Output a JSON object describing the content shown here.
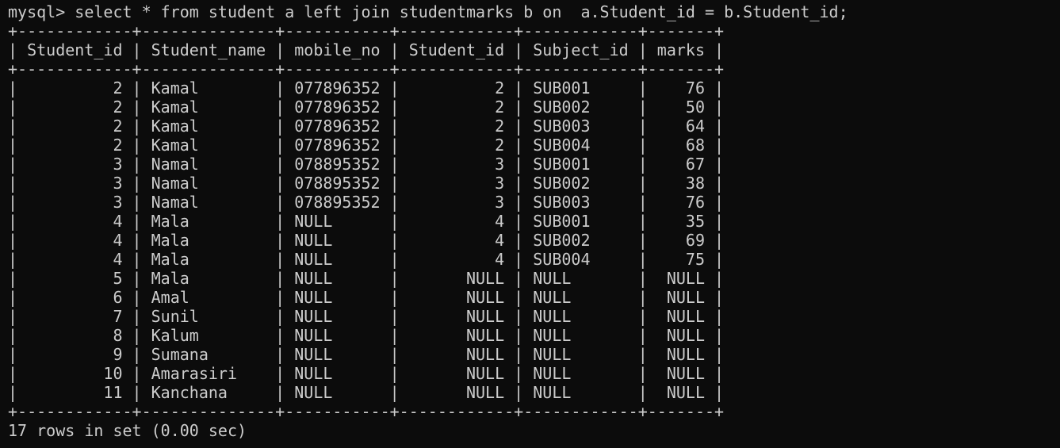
{
  "terminal": {
    "prompt": "mysql> ",
    "command": "select * from student a left join studentmarks b on  a.Student_id = b.Student_id;",
    "columns": [
      {
        "name": "Student_id",
        "align": "right"
      },
      {
        "name": "Student_name",
        "align": "left"
      },
      {
        "name": "mobile_no",
        "align": "left"
      },
      {
        "name": "Student_id",
        "align": "right"
      },
      {
        "name": "Subject_id",
        "align": "left"
      },
      {
        "name": "marks",
        "align": "right"
      }
    ],
    "rows": [
      [
        "2",
        "Kamal",
        "077896352",
        "2",
        "SUB001",
        "76"
      ],
      [
        "2",
        "Kamal",
        "077896352",
        "2",
        "SUB002",
        "50"
      ],
      [
        "2",
        "Kamal",
        "077896352",
        "2",
        "SUB003",
        "64"
      ],
      [
        "2",
        "Kamal",
        "077896352",
        "2",
        "SUB004",
        "68"
      ],
      [
        "3",
        "Namal",
        "078895352",
        "3",
        "SUB001",
        "67"
      ],
      [
        "3",
        "Namal",
        "078895352",
        "3",
        "SUB002",
        "38"
      ],
      [
        "3",
        "Namal",
        "078895352",
        "3",
        "SUB003",
        "76"
      ],
      [
        "4",
        "Mala",
        "NULL",
        "4",
        "SUB001",
        "35"
      ],
      [
        "4",
        "Mala",
        "NULL",
        "4",
        "SUB002",
        "69"
      ],
      [
        "4",
        "Mala",
        "NULL",
        "4",
        "SUB004",
        "75"
      ],
      [
        "5",
        "Mala",
        "NULL",
        "NULL",
        "NULL",
        "NULL"
      ],
      [
        "6",
        "Amal",
        "NULL",
        "NULL",
        "NULL",
        "NULL"
      ],
      [
        "7",
        "Sunil",
        "NULL",
        "NULL",
        "NULL",
        "NULL"
      ],
      [
        "8",
        "Kalum",
        "NULL",
        "NULL",
        "NULL",
        "NULL"
      ],
      [
        "9",
        "Sumana",
        "NULL",
        "NULL",
        "NULL",
        "NULL"
      ],
      [
        "10",
        "Amarasiri",
        "NULL",
        "NULL",
        "NULL",
        "NULL"
      ],
      [
        "11",
        "Kanchana",
        "NULL",
        "NULL",
        "NULL",
        "NULL"
      ]
    ],
    "footer": "17 rows in set (0.00 sec)"
  },
  "colors": {
    "background": "#0c0c0c",
    "foreground": "#cccccc"
  }
}
